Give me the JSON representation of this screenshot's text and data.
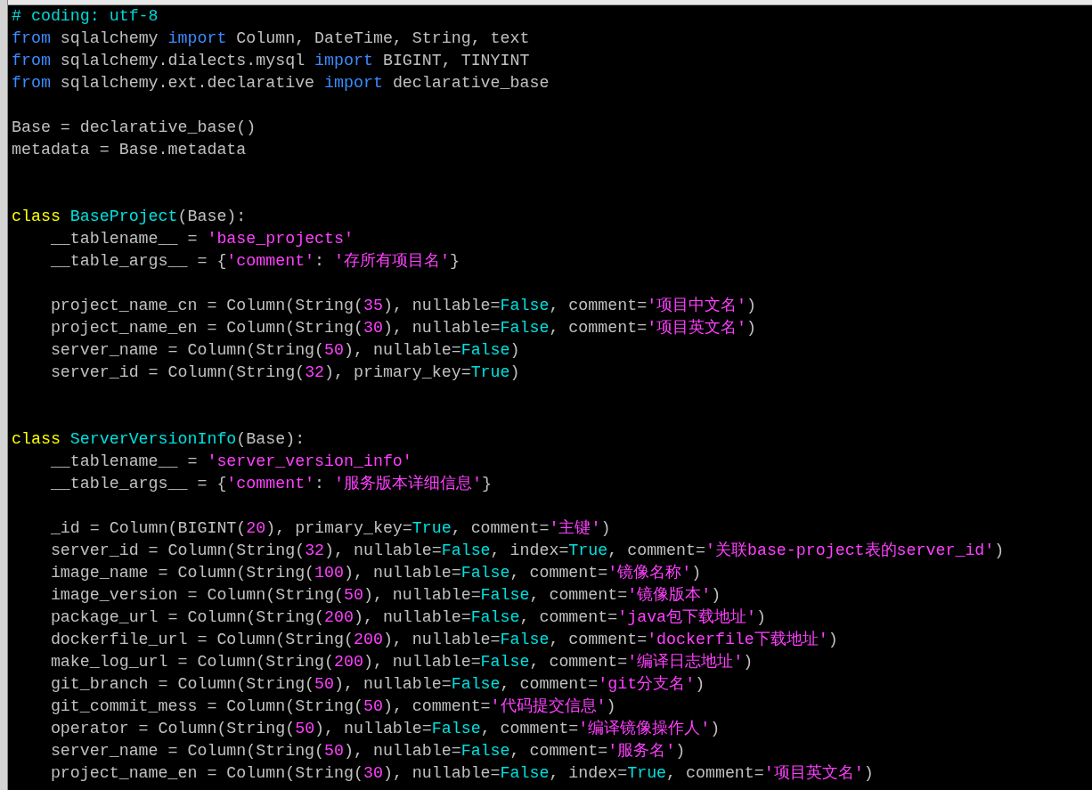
{
  "lines": [
    {
      "kind": "code",
      "parts": [
        {
          "kind": "comment",
          "text": "# coding: utf-8"
        }
      ]
    },
    {
      "kind": "code",
      "parts": [
        {
          "kind": "keyword",
          "text": "from"
        },
        {
          "kind": "plain",
          "text": " sqlalchemy "
        },
        {
          "kind": "keyword",
          "text": "import"
        },
        {
          "kind": "plain",
          "text": " Column, DateTime, String, text"
        }
      ]
    },
    {
      "kind": "code",
      "parts": [
        {
          "kind": "keyword",
          "text": "from"
        },
        {
          "kind": "plain",
          "text": " sqlalchemy.dialects.mysql "
        },
        {
          "kind": "keyword",
          "text": "import"
        },
        {
          "kind": "plain",
          "text": " BIGINT, TINYINT"
        }
      ]
    },
    {
      "kind": "code",
      "parts": [
        {
          "kind": "keyword",
          "text": "from"
        },
        {
          "kind": "plain",
          "text": " sqlalchemy.ext.declarative "
        },
        {
          "kind": "keyword",
          "text": "import"
        },
        {
          "kind": "plain",
          "text": " declarative_base"
        }
      ]
    },
    {
      "kind": "blank"
    },
    {
      "kind": "code",
      "parts": [
        {
          "kind": "plain",
          "text": "Base = declarative_base()"
        }
      ]
    },
    {
      "kind": "code",
      "parts": [
        {
          "kind": "plain",
          "text": "metadata = Base.metadata"
        }
      ]
    },
    {
      "kind": "blank"
    },
    {
      "kind": "blank"
    },
    {
      "kind": "code",
      "parts": [
        {
          "kind": "statement",
          "text": "class "
        },
        {
          "kind": "type",
          "text": "BaseProject"
        },
        {
          "kind": "plain",
          "text": "(Base):"
        }
      ]
    },
    {
      "kind": "code",
      "parts": [
        {
          "kind": "plain",
          "text": "    __tablename__ = "
        },
        {
          "kind": "string",
          "text": "'base_projects'"
        }
      ]
    },
    {
      "kind": "code",
      "parts": [
        {
          "kind": "plain",
          "text": "    __table_args__ = {"
        },
        {
          "kind": "string",
          "text": "'comment'"
        },
        {
          "kind": "plain",
          "text": ": "
        },
        {
          "kind": "string",
          "text": "'存所有项目名'"
        },
        {
          "kind": "plain",
          "text": "}"
        }
      ]
    },
    {
      "kind": "blank"
    },
    {
      "kind": "code",
      "parts": [
        {
          "kind": "plain",
          "text": "    project_name_cn = Column(String("
        },
        {
          "kind": "number",
          "text": "35"
        },
        {
          "kind": "plain",
          "text": "), nullable="
        },
        {
          "kind": "constant",
          "text": "False"
        },
        {
          "kind": "plain",
          "text": ", comment="
        },
        {
          "kind": "string",
          "text": "'项目中文名'"
        },
        {
          "kind": "plain",
          "text": ")"
        }
      ]
    },
    {
      "kind": "code",
      "parts": [
        {
          "kind": "plain",
          "text": "    project_name_en = Column(String("
        },
        {
          "kind": "number",
          "text": "30"
        },
        {
          "kind": "plain",
          "text": "), nullable="
        },
        {
          "kind": "constant",
          "text": "False"
        },
        {
          "kind": "plain",
          "text": ", comment="
        },
        {
          "kind": "string",
          "text": "'项目英文名'"
        },
        {
          "kind": "plain",
          "text": ")"
        }
      ]
    },
    {
      "kind": "code",
      "parts": [
        {
          "kind": "plain",
          "text": "    server_name = Column(String("
        },
        {
          "kind": "number",
          "text": "50"
        },
        {
          "kind": "plain",
          "text": "), nullable="
        },
        {
          "kind": "constant",
          "text": "False"
        },
        {
          "kind": "plain",
          "text": ")"
        }
      ]
    },
    {
      "kind": "code",
      "parts": [
        {
          "kind": "plain",
          "text": "    server_id = Column(String("
        },
        {
          "kind": "number",
          "text": "32"
        },
        {
          "kind": "plain",
          "text": "), primary_key="
        },
        {
          "kind": "constant",
          "text": "True"
        },
        {
          "kind": "plain",
          "text": ")"
        }
      ]
    },
    {
      "kind": "blank"
    },
    {
      "kind": "blank"
    },
    {
      "kind": "code",
      "parts": [
        {
          "kind": "statement",
          "text": "class "
        },
        {
          "kind": "type",
          "text": "ServerVersionInfo"
        },
        {
          "kind": "plain",
          "text": "(Base):"
        }
      ]
    },
    {
      "kind": "code",
      "parts": [
        {
          "kind": "plain",
          "text": "    __tablename__ = "
        },
        {
          "kind": "string",
          "text": "'server_version_info'"
        }
      ]
    },
    {
      "kind": "code",
      "parts": [
        {
          "kind": "plain",
          "text": "    __table_args__ = {"
        },
        {
          "kind": "string",
          "text": "'comment'"
        },
        {
          "kind": "plain",
          "text": ": "
        },
        {
          "kind": "string",
          "text": "'服务版本详细信息'"
        },
        {
          "kind": "plain",
          "text": "}"
        }
      ]
    },
    {
      "kind": "blank"
    },
    {
      "kind": "code",
      "parts": [
        {
          "kind": "plain",
          "text": "    _id = Column(BIGINT("
        },
        {
          "kind": "number",
          "text": "20"
        },
        {
          "kind": "plain",
          "text": "), primary_key="
        },
        {
          "kind": "constant",
          "text": "True"
        },
        {
          "kind": "plain",
          "text": ", comment="
        },
        {
          "kind": "string",
          "text": "'主键'"
        },
        {
          "kind": "plain",
          "text": ")"
        }
      ]
    },
    {
      "kind": "code",
      "parts": [
        {
          "kind": "plain",
          "text": "    server_id = Column(String("
        },
        {
          "kind": "number",
          "text": "32"
        },
        {
          "kind": "plain",
          "text": "), nullable="
        },
        {
          "kind": "constant",
          "text": "False"
        },
        {
          "kind": "plain",
          "text": ", index="
        },
        {
          "kind": "constant",
          "text": "True"
        },
        {
          "kind": "plain",
          "text": ", comment="
        },
        {
          "kind": "string",
          "text": "'关联base-project表的server_id'"
        },
        {
          "kind": "plain",
          "text": ")"
        }
      ]
    },
    {
      "kind": "code",
      "parts": [
        {
          "kind": "plain",
          "text": "    image_name = Column(String("
        },
        {
          "kind": "number",
          "text": "100"
        },
        {
          "kind": "plain",
          "text": "), nullable="
        },
        {
          "kind": "constant",
          "text": "False"
        },
        {
          "kind": "plain",
          "text": ", comment="
        },
        {
          "kind": "string",
          "text": "'镜像名称'"
        },
        {
          "kind": "plain",
          "text": ")"
        }
      ]
    },
    {
      "kind": "code",
      "parts": [
        {
          "kind": "plain",
          "text": "    image_version = Column(String("
        },
        {
          "kind": "number",
          "text": "50"
        },
        {
          "kind": "plain",
          "text": "), nullable="
        },
        {
          "kind": "constant",
          "text": "False"
        },
        {
          "kind": "plain",
          "text": ", comment="
        },
        {
          "kind": "string",
          "text": "'镜像版本'"
        },
        {
          "kind": "plain",
          "text": ")"
        }
      ]
    },
    {
      "kind": "code",
      "parts": [
        {
          "kind": "plain",
          "text": "    package_url = Column(String("
        },
        {
          "kind": "number",
          "text": "200"
        },
        {
          "kind": "plain",
          "text": "), nullable="
        },
        {
          "kind": "constant",
          "text": "False"
        },
        {
          "kind": "plain",
          "text": ", comment="
        },
        {
          "kind": "string",
          "text": "'java包下载地址'"
        },
        {
          "kind": "plain",
          "text": ")"
        }
      ]
    },
    {
      "kind": "code",
      "parts": [
        {
          "kind": "plain",
          "text": "    dockerfile_url = Column(String("
        },
        {
          "kind": "number",
          "text": "200"
        },
        {
          "kind": "plain",
          "text": "), nullable="
        },
        {
          "kind": "constant",
          "text": "False"
        },
        {
          "kind": "plain",
          "text": ", comment="
        },
        {
          "kind": "string",
          "text": "'dockerfile下载地址'"
        },
        {
          "kind": "plain",
          "text": ")"
        }
      ]
    },
    {
      "kind": "code",
      "parts": [
        {
          "kind": "plain",
          "text": "    make_log_url = Column(String("
        },
        {
          "kind": "number",
          "text": "200"
        },
        {
          "kind": "plain",
          "text": "), nullable="
        },
        {
          "kind": "constant",
          "text": "False"
        },
        {
          "kind": "plain",
          "text": ", comment="
        },
        {
          "kind": "string",
          "text": "'编译日志地址'"
        },
        {
          "kind": "plain",
          "text": ")"
        }
      ]
    },
    {
      "kind": "code",
      "parts": [
        {
          "kind": "plain",
          "text": "    git_branch = Column(String("
        },
        {
          "kind": "number",
          "text": "50"
        },
        {
          "kind": "plain",
          "text": "), nullable="
        },
        {
          "kind": "constant",
          "text": "False"
        },
        {
          "kind": "plain",
          "text": ", comment="
        },
        {
          "kind": "string",
          "text": "'git分支名'"
        },
        {
          "kind": "plain",
          "text": ")"
        }
      ]
    },
    {
      "kind": "code",
      "parts": [
        {
          "kind": "plain",
          "text": "    git_commit_mess = Column(String("
        },
        {
          "kind": "number",
          "text": "50"
        },
        {
          "kind": "plain",
          "text": "), comment="
        },
        {
          "kind": "string",
          "text": "'代码提交信息'"
        },
        {
          "kind": "plain",
          "text": ")"
        }
      ]
    },
    {
      "kind": "code",
      "parts": [
        {
          "kind": "plain",
          "text": "    operator = Column(String("
        },
        {
          "kind": "number",
          "text": "50"
        },
        {
          "kind": "plain",
          "text": "), nullable="
        },
        {
          "kind": "constant",
          "text": "False"
        },
        {
          "kind": "plain",
          "text": ", comment="
        },
        {
          "kind": "string",
          "text": "'编译镜像操作人'"
        },
        {
          "kind": "plain",
          "text": ")"
        }
      ]
    },
    {
      "kind": "code",
      "parts": [
        {
          "kind": "plain",
          "text": "    server_name = Column(String("
        },
        {
          "kind": "number",
          "text": "50"
        },
        {
          "kind": "plain",
          "text": "), nullable="
        },
        {
          "kind": "constant",
          "text": "False"
        },
        {
          "kind": "plain",
          "text": ", comment="
        },
        {
          "kind": "string",
          "text": "'服务名'"
        },
        {
          "kind": "plain",
          "text": ")"
        }
      ]
    },
    {
      "kind": "code",
      "parts": [
        {
          "kind": "plain",
          "text": "    project_name_en = Column(String("
        },
        {
          "kind": "number",
          "text": "30"
        },
        {
          "kind": "plain",
          "text": "), nullable="
        },
        {
          "kind": "constant",
          "text": "False"
        },
        {
          "kind": "plain",
          "text": ", index="
        },
        {
          "kind": "constant",
          "text": "True"
        },
        {
          "kind": "plain",
          "text": ", comment="
        },
        {
          "kind": "string",
          "text": "'项目英文名'"
        },
        {
          "kind": "plain",
          "text": ")"
        }
      ]
    }
  ]
}
